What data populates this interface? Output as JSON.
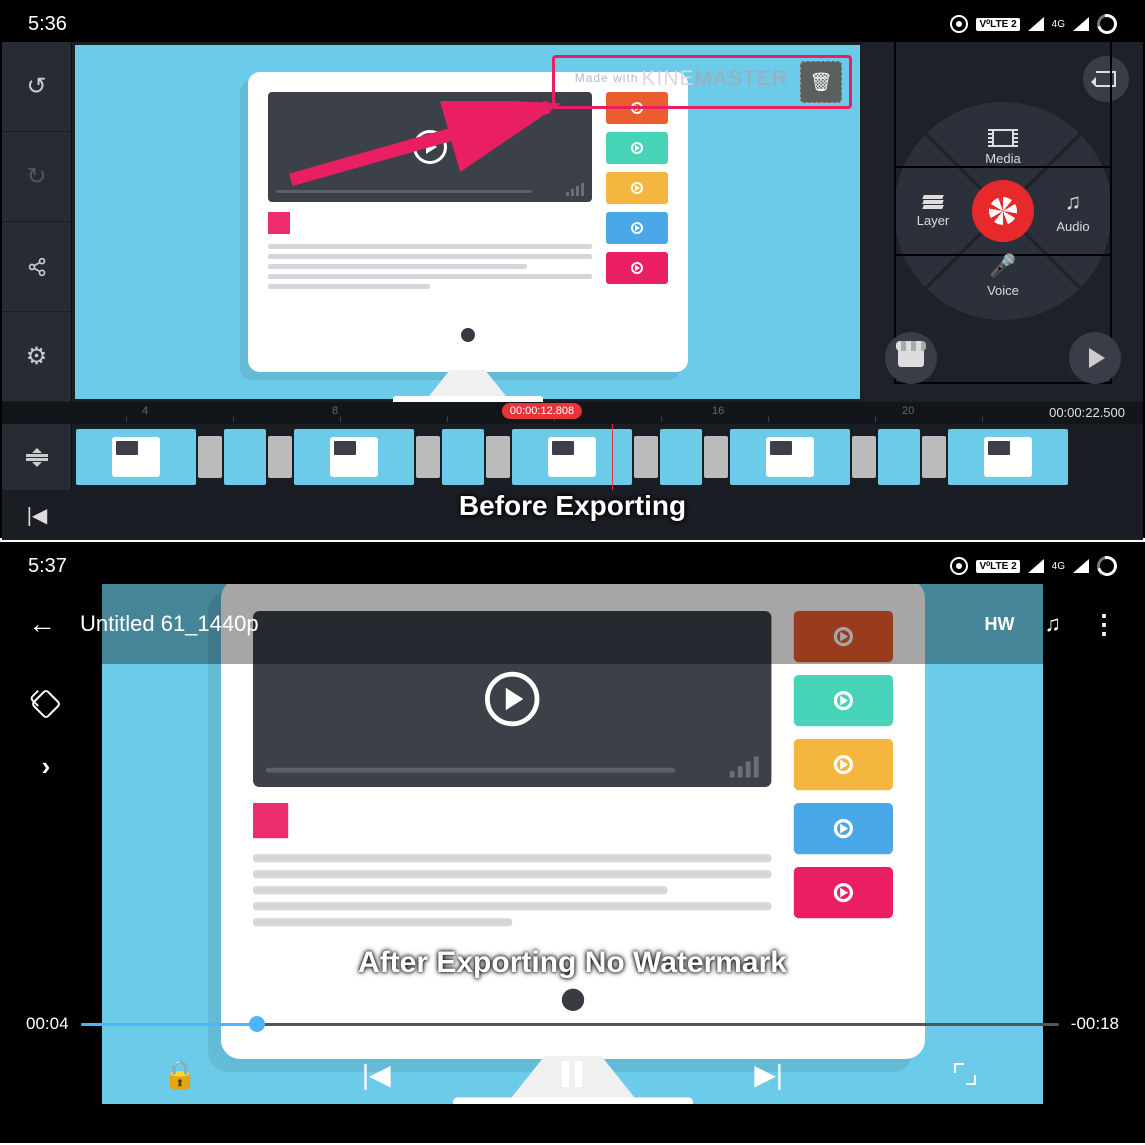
{
  "top": {
    "statusbar": {
      "time": "5:36",
      "volte": "V⁰LTE 2",
      "net": "4G"
    },
    "sidebar": {
      "undo": "↺",
      "redo": "↻",
      "share": "share",
      "settings": "⚙"
    },
    "watermark": {
      "made": "Made with",
      "brand1": "KINE",
      "brand2": "MASTER"
    },
    "wheel": {
      "media": "Media",
      "audio": "Audio",
      "voice": "Voice",
      "layer": "Layer"
    },
    "ruler": {
      "ticks": [
        "4",
        "8",
        "12",
        "16",
        "20"
      ],
      "playhead": "00:00:12.808",
      "duration": "00:00:22.500"
    },
    "caption": "Before Exporting"
  },
  "bottom": {
    "statusbar": {
      "time": "5:37",
      "volte": "V⁰LTE 2",
      "net": "4G"
    },
    "title": "Untitled 61_1440p",
    "hw": "HW",
    "seek": {
      "current": "00:04",
      "remaining": "-00:18"
    },
    "caption": "After Exporting No Watermark"
  },
  "thumbs": [
    "#eb5c2e",
    "#47d3b7",
    "#f4b63f",
    "#4aa8e8",
    "#e91e63"
  ]
}
